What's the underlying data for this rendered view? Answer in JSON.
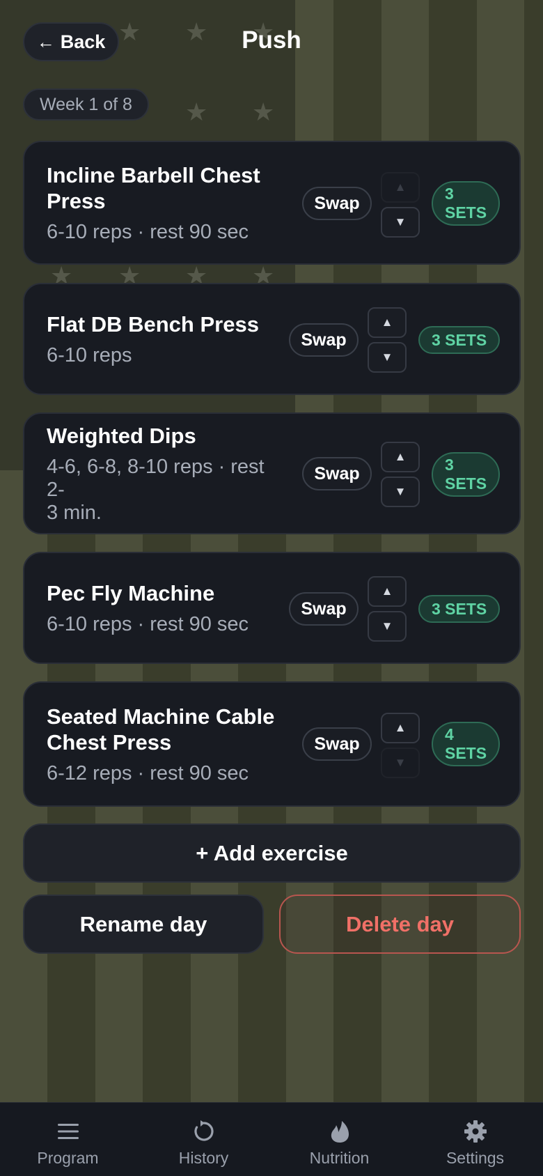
{
  "header": {
    "back_label": "Back",
    "back_arrow": "←",
    "title": "Push"
  },
  "week_badge": "Week 1 of 8",
  "exercises": [
    {
      "name_lines": [
        "Incline Barbell Chest",
        "Press"
      ],
      "reps": "6-10 reps",
      "rest": "rest 90 sec",
      "swap_label": "Swap",
      "up_enabled": false,
      "down_enabled": true,
      "sets_lines": [
        "3",
        "SETS"
      ]
    },
    {
      "name_lines": [
        "Flat DB Bench Press"
      ],
      "reps": "6-10 reps",
      "rest": "",
      "swap_label": "Swap",
      "up_enabled": true,
      "down_enabled": true,
      "sets_lines": [
        "3 SETS"
      ]
    },
    {
      "name_lines": [
        "Weighted Dips"
      ],
      "reps": "4-6, 6-8, 8-10 reps",
      "rest": "rest 2-",
      "rest_cont": "3 min.",
      "swap_label": "Swap",
      "up_enabled": true,
      "down_enabled": true,
      "sets_lines": [
        "3",
        "SETS"
      ]
    },
    {
      "name_lines": [
        "Pec Fly Machine"
      ],
      "reps": "6-10 reps",
      "rest": "rest 90 sec",
      "swap_label": "Swap",
      "up_enabled": true,
      "down_enabled": true,
      "sets_lines": [
        "3 SETS"
      ]
    },
    {
      "name_lines": [
        "Seated Machine Cable",
        "Chest Press"
      ],
      "reps": "6-12 reps",
      "rest": "rest 90 sec",
      "swap_label": "Swap",
      "up_enabled": true,
      "down_enabled": false,
      "sets_lines": [
        "4",
        "SETS"
      ]
    }
  ],
  "arrows": {
    "up": "▲",
    "down": "▼",
    "separator": "·"
  },
  "actions": {
    "add_label": "+ Add exercise",
    "rename_label": "Rename day",
    "delete_label": "Delete day"
  },
  "tabs": [
    {
      "label": "Program",
      "icon": "menu-icon"
    },
    {
      "label": "History",
      "icon": "history-icon"
    },
    {
      "label": "Nutrition",
      "icon": "flame-icon"
    },
    {
      "label": "Settings",
      "icon": "gear-icon"
    }
  ],
  "colors": {
    "accent_green": "#5fd3a4",
    "danger_red": "#f07067",
    "card_bg": "#181b22"
  }
}
